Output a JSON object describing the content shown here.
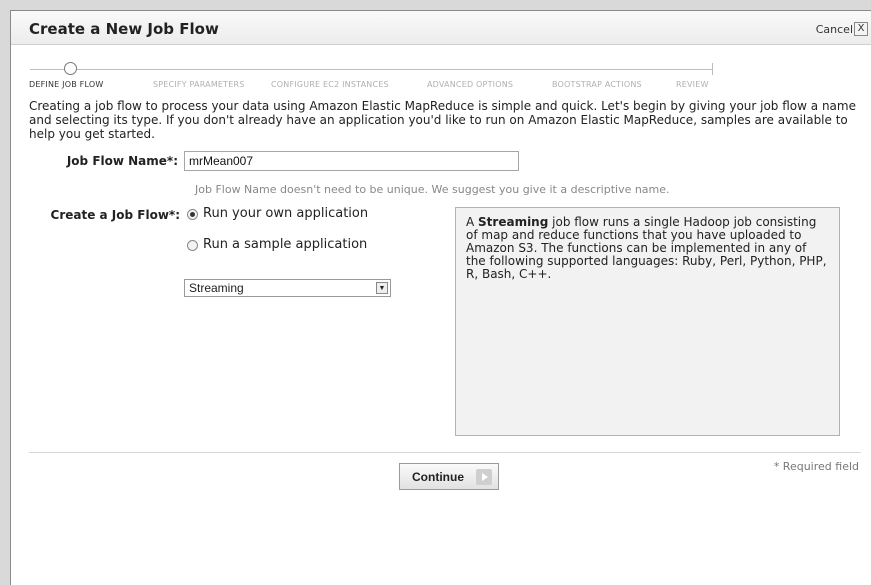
{
  "dialog": {
    "title": "Create a New Job Flow",
    "cancel_label": "Cancel",
    "close_glyph": "X"
  },
  "steps": [
    {
      "label": "DEFINE JOB FLOW",
      "active": true
    },
    {
      "label": "SPECIFY PARAMETERS",
      "active": false
    },
    {
      "label": "CONFIGURE EC2 INSTANCES",
      "active": false
    },
    {
      "label": "ADVANCED OPTIONS",
      "active": false
    },
    {
      "label": "BOOTSTRAP ACTIONS",
      "active": false
    },
    {
      "label": "REVIEW",
      "active": false
    }
  ],
  "intro": "Creating a job flow to process your data using Amazon Elastic MapReduce is simple and quick. Let's begin by giving your job flow a name and selecting its type. If you don't already have an application you'd like to run on Amazon Elastic MapReduce, samples are available to help you get started.",
  "form": {
    "name_label": "Job Flow Name*:",
    "name_value": "mrMean007",
    "name_hint": "Job Flow Name doesn't need to be unique. We suggest you give it a descriptive name.",
    "type_label": "Create a Job Flow*:",
    "options": [
      {
        "label": "Run your own application",
        "selected": true
      },
      {
        "label": "Run a sample application",
        "selected": false
      }
    ],
    "select_value": "Streaming"
  },
  "info": {
    "prefix": "A ",
    "bold": "Streaming",
    "text": " job flow runs a single Hadoop job consisting of map and reduce functions that you have uploaded to Amazon S3. The functions can be implemented in any of the following supported languages: Ruby, Perl, Python, PHP, R, Bash, C++."
  },
  "footer": {
    "continue_label": "Continue",
    "required_note": "* Required field"
  },
  "icons": {
    "close": "close-icon",
    "continue_arrow": "arrow-right-icon",
    "select_arrow": "chevron-down-icon",
    "step_marker": "step-marker-icon"
  }
}
